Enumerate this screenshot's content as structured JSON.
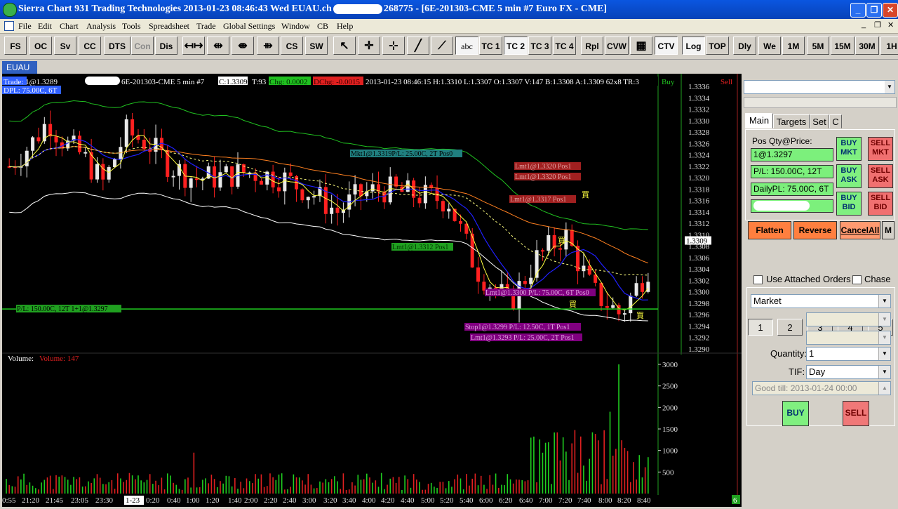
{
  "window": {
    "title": "Sierra Chart 931 Trading Technologies 2013-01-23  08:46:43 Wed  EUAU.ch",
    "title_tail": "268775 - [6E-201303-CME  5 min   #7  Euro FX - CME]"
  },
  "menu": [
    "File",
    "Edit",
    "Chart",
    "Analysis",
    "Tools",
    "Spreadsheet",
    "Trade",
    "Global Settings",
    "Window",
    "CB",
    "Help"
  ],
  "toolbar": {
    "buttons": [
      "FS",
      "OC",
      "Sv",
      "CC",
      "DTS",
      "Con",
      "Dis",
      "CS",
      "SW",
      "abc",
      "TC 1",
      "TC 2",
      "TC 3",
      "TC 4",
      "Rpl",
      "CVW",
      "CTV",
      "Log",
      "TOP",
      "Dly",
      "We",
      "1M",
      "5M",
      "15M",
      "30M",
      "1H"
    ],
    "disabled": [
      "Con"
    ],
    "pressed": [
      "abc",
      "TC 2",
      "CTV",
      "Log"
    ]
  },
  "chart_tab": "EUAU",
  "chart": {
    "header": {
      "trade": "Trade: 1@1.3289",
      "symbol": "6E-201303-CME  5 min   #7",
      "close": "C:1.3309",
      "ticks": "T:93",
      "chg": "Chg: 0.0002",
      "dchg": "DChg: -0.0015",
      "ohlc": "2013-01-23 08:46:15 H:1.3310 L:1.3307 O:1.3307 V:147 B:1.3308 A:1.3309 62x8 TR:3",
      "dpl": "DPL: 75.00C, 6T",
      "buy": "Buy",
      "sell": "Sell"
    },
    "price_axis": [
      "1.3336",
      "1.3334",
      "1.3332",
      "1.3330",
      "1.3328",
      "1.3326",
      "1.3324",
      "1.3322",
      "1.3320",
      "1.3318",
      "1.3316",
      "1.3314",
      "1.3312",
      "1.3310",
      "1.3308",
      "1.3306",
      "1.3304",
      "1.3302",
      "1.3300",
      "1.3298",
      "1.3296",
      "1.3294",
      "1.3292",
      "1.3290"
    ],
    "last_price_label": "1.3309",
    "volume_axis": [
      "3000",
      "2500",
      "2000",
      "1500",
      "1000",
      "500"
    ],
    "time_axis": [
      "0:55",
      "21:20",
      "21:45",
      "23:05",
      "23:30",
      "1-23",
      "0:20",
      "0:40",
      "1:00",
      "1:20",
      "1:40",
      "2:00",
      "2:20",
      "2:40",
      "3:00",
      "3:20",
      "3:40",
      "4:00",
      "4:20",
      "4:40",
      "5:00",
      "5:20",
      "5:40",
      "6:00",
      "6:20",
      "6:40",
      "7:00",
      "7:20",
      "7:40",
      "8:00",
      "8:20",
      "8:40"
    ],
    "volume_label": "Volume:",
    "volume_value": "Volume: 147",
    "corner_badge": "6",
    "orders": {
      "mkt": "Mkt1@1.3319P/L: 25.00C, 2T Pos0",
      "lmt1": "Lmt1@1.3320 Pos1",
      "lmt2": "Lmt1@1.3320 Pos1",
      "lmt3": "Lmt1@1.3317 Pos1",
      "lmt_green": "Lmt1@1.3312 Pos1",
      "lmt_purple": "Lmt1@1.3300 P/L: 75.00C, 6T Pos0",
      "pl_line": "P/L: 150.00C, 12T 1+1@1.3297",
      "stop": "Stop1@1.3299 P/L: 12.50C, 1T Pos1",
      "lmt_bottom": "Lmt1@1.3293 P/L: 25.00C, 2T Pos1"
    },
    "markers": [
      "買",
      "買",
      "買",
      "買"
    ],
    "colors": {
      "up": "#e8e8e8",
      "down": "#ff2020",
      "vol_up": "#20d020",
      "vol_down": "#e02020",
      "ma_fast": "#ffff40",
      "ma_mid": "#2020ff",
      "band_upper": "#20c020",
      "band_lower": "#ffffff",
      "ma_slow": "#ff8020",
      "pl_line": "#20d020"
    }
  },
  "trade_panel": {
    "tabs": [
      "Main",
      "Targets",
      "Set",
      "C"
    ],
    "pos_label": "Pos Qty@Price:",
    "pos_value": "1@1.3297",
    "pl_value": "P/L: 150.00C, 12T",
    "daily_pl": "DailyPL: 75.00C, 6T",
    "buttons": {
      "buy_mkt": "BUY MKT",
      "sell_mkt": "SELL MKT",
      "buy_ask": "BUY ASK",
      "sell_ask": "SELL ASK",
      "buy_bid": "BUY BID",
      "sell_bid": "SELL BID"
    },
    "actions": [
      "Flatten",
      "Reverse",
      "CancelAll",
      "M"
    ],
    "qty_buttons": [
      "1",
      "2",
      "3",
      "4",
      "5"
    ],
    "use_attached": "Use Attached Orders",
    "chase": "Chase",
    "order_type": "Market",
    "quantity_label": "Quantity:",
    "quantity": "1",
    "tif_label": "TIF:",
    "tif": "Day",
    "good_till": "Good till: 2013-01-24 00:00",
    "buy": "BUY",
    "sell": "SELL"
  }
}
